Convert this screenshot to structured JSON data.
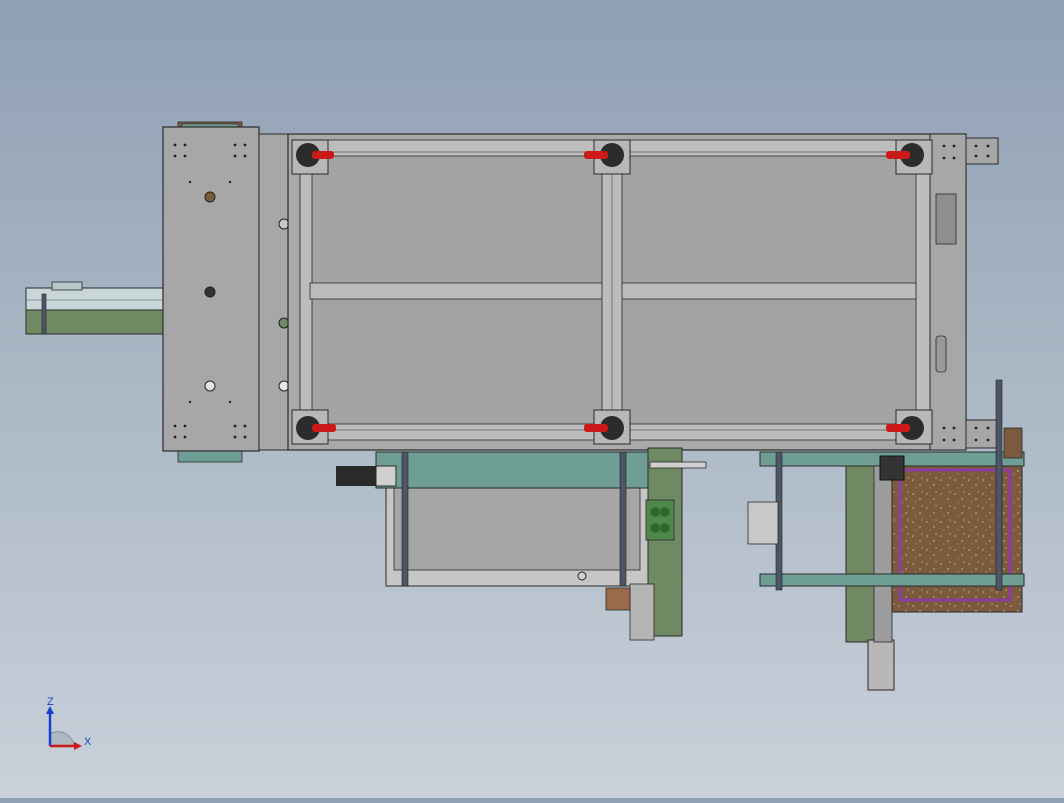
{
  "viewport": {
    "background_top": "#8fa0b4",
    "background_bottom": "#c9d1da",
    "frame_color": "#a7a7a7",
    "rail_color": "#b4b4b4",
    "outline_color": "#2a2a2a",
    "accent_red": "#cc1a1a",
    "accent_teal": "#6f9e95",
    "accent_green": "#6f8a63",
    "accent_brown": "#7b5a3e",
    "accent_purple": "#8a3da0"
  },
  "triad": {
    "z_label": "Z",
    "x_label": "X",
    "icon": "coordinate-triad-icon"
  }
}
